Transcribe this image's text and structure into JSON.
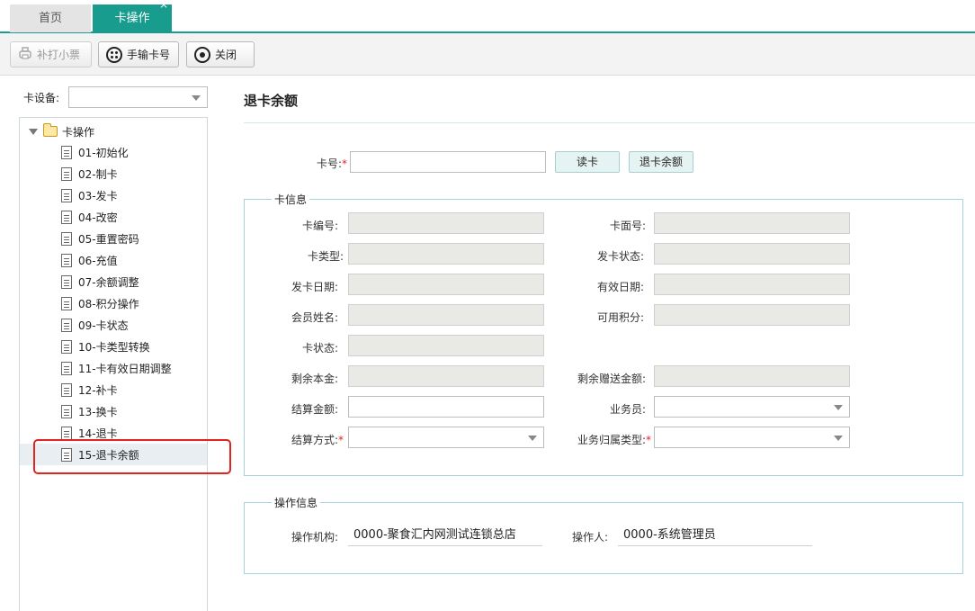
{
  "tabs": [
    {
      "label": "首页"
    },
    {
      "label": "卡操作",
      "close": "×"
    }
  ],
  "toolbar": {
    "reprint_label": "补打小票",
    "manual_label": "手输卡号",
    "close_label": "关闭"
  },
  "left": {
    "device_label": "卡设备:",
    "device_value": "",
    "tree_root": "卡操作",
    "items": [
      {
        "label": "01-初始化"
      },
      {
        "label": "02-制卡"
      },
      {
        "label": "03-发卡"
      },
      {
        "label": "04-改密"
      },
      {
        "label": "05-重置密码"
      },
      {
        "label": "06-充值"
      },
      {
        "label": "07-余额调整"
      },
      {
        "label": "08-积分操作"
      },
      {
        "label": "09-卡状态"
      },
      {
        "label": "10-卡类型转换"
      },
      {
        "label": "11-卡有效日期调整"
      },
      {
        "label": "12-补卡"
      },
      {
        "label": "13-换卡"
      },
      {
        "label": "14-退卡"
      },
      {
        "label": "15-退卡余额"
      }
    ],
    "selected_index": 14
  },
  "main": {
    "title": "退卡余额",
    "card_no_label": "卡号:",
    "card_no_value": "",
    "read_card_button": "读卡",
    "refund_button": "退卡余额",
    "required_mark": "*",
    "card_info": {
      "legend": "卡信息",
      "card_code_label": "卡编号:",
      "face_no_label": "卡面号:",
      "card_type_label": "卡类型:",
      "issue_status_label": "发卡状态:",
      "issue_date_label": "发卡日期:",
      "valid_date_label": "有效日期:",
      "member_name_label": "会员姓名:",
      "points_label": "可用积分:",
      "card_status_label": "卡状态:",
      "principal_label": "剩余本金:",
      "gift_amount_label": "剩余赠送金额:",
      "settle_amount_label": "结算金额:",
      "salesperson_label": "业务员:",
      "settle_method_label": "结算方式:",
      "business_type_label": "业务归属类型:"
    },
    "op_info": {
      "legend": "操作信息",
      "org_label": "操作机构:",
      "org_value": "0000-聚食汇内网测试连锁总店",
      "operator_label": "操作人:",
      "operator_value": "0000-系统管理员"
    }
  },
  "colors": {
    "accent": "#189c8e",
    "highlight": "#e0241f"
  }
}
